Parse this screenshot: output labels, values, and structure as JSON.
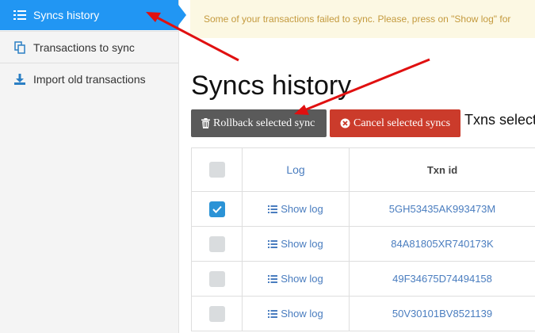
{
  "sidebar": {
    "items": [
      {
        "label": "Syncs history",
        "icon": "list-icon",
        "active": true
      },
      {
        "label": "Transactions to sync",
        "icon": "copy-icon",
        "active": false
      },
      {
        "label": "Import old transactions",
        "icon": "download-icon",
        "active": false
      }
    ]
  },
  "banner": {
    "text": "Some of your transactions failed to sync. Please, press on \"Show log\" for"
  },
  "page": {
    "title": "Syncs history"
  },
  "toolbar": {
    "rollback_label": "Rollback selected sync",
    "cancel_label": "Cancel selected syncs",
    "selected_text": "Txns select"
  },
  "table": {
    "columns": [
      "",
      "Log",
      "Txn id"
    ],
    "rows": [
      {
        "checked": true,
        "log": "Show log",
        "txn_id": "5GH53435AK993473M"
      },
      {
        "checked": false,
        "log": "Show log",
        "txn_id": "84A81805XR740173K"
      },
      {
        "checked": false,
        "log": "Show log",
        "txn_id": "49F34675D74494158"
      },
      {
        "checked": false,
        "log": "Show log",
        "txn_id": "50V30101BV8521139"
      }
    ]
  },
  "colors": {
    "accent": "#2196f3",
    "banner_bg": "#fcf8e3",
    "banner_text": "#c49a3e",
    "rollback_bg": "#5a5a5a",
    "cancel_bg": "#cb3b2b",
    "link": "#4a7dbf",
    "annotation_arrow": "#e01010"
  }
}
